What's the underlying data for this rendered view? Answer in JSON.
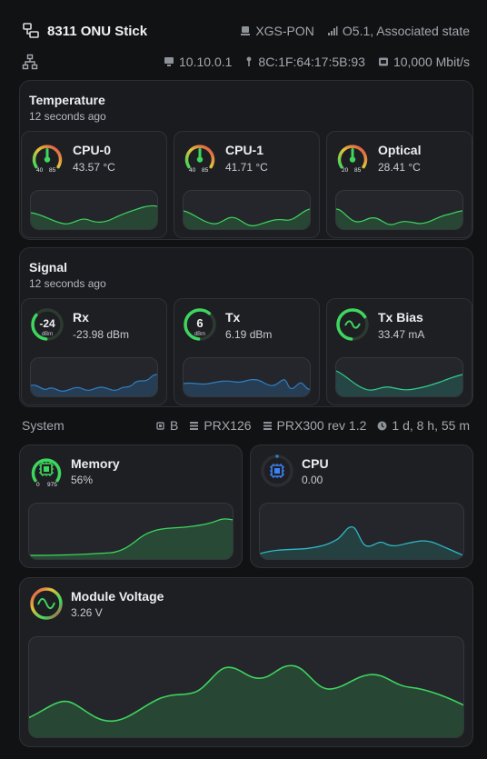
{
  "header": {
    "device_name": "8311 ONU Stick",
    "pon_type": "XGS-PON",
    "pon_state": "O5.1, Associated state",
    "ip_address": "10.10.0.1",
    "mac_address": "8C:1F:64:17:5B:93",
    "link_speed": "10,000 Mbit/s"
  },
  "temperature": {
    "title": "Temperature",
    "updated": "12 seconds ago",
    "items": [
      {
        "name": "CPU-0",
        "value": "43.57 °C",
        "gauge_min": "40",
        "gauge_max": "85",
        "level": 0.1
      },
      {
        "name": "CPU-1",
        "value": "41.71 °C",
        "gauge_min": "40",
        "gauge_max": "85",
        "level": 0.04
      },
      {
        "name": "Optical",
        "value": "28.41 °C",
        "gauge_min": "20",
        "gauge_max": "85",
        "level": 0.13
      }
    ]
  },
  "signal": {
    "title": "Signal",
    "updated": "12 seconds ago",
    "items": [
      {
        "name": "Rx",
        "value": "-23.98 dBm",
        "gauge_value": "-24",
        "gauge_unit": "dBm",
        "level": 0.35
      },
      {
        "name": "Tx",
        "value": "6.19 dBm",
        "gauge_value": "6",
        "gauge_unit": "dBm",
        "level": 0.6
      },
      {
        "name": "Tx Bias",
        "value": "33.47 mA",
        "level": 0.65
      }
    ]
  },
  "system": {
    "label": "System",
    "firmware_bank": "B",
    "cpu_model": "PRX126",
    "board": "PRX300 rev 1.2",
    "uptime": "1 d, 8 h, 55 m"
  },
  "memory": {
    "name": "Memory",
    "value": "56%",
    "gauge_min": "0",
    "gauge_max": "975",
    "level": 0.56
  },
  "cpu": {
    "name": "CPU",
    "value": "0.00",
    "level": 0.0
  },
  "voltage": {
    "name": "Module Voltage",
    "value": "3.26 V"
  },
  "colors": {
    "green": "#3ed65e",
    "blue": "#2f6aa1",
    "teal": "#2fb8a6",
    "card_bg": "#1a1b1f",
    "tile_bg": "#1e1f23"
  }
}
